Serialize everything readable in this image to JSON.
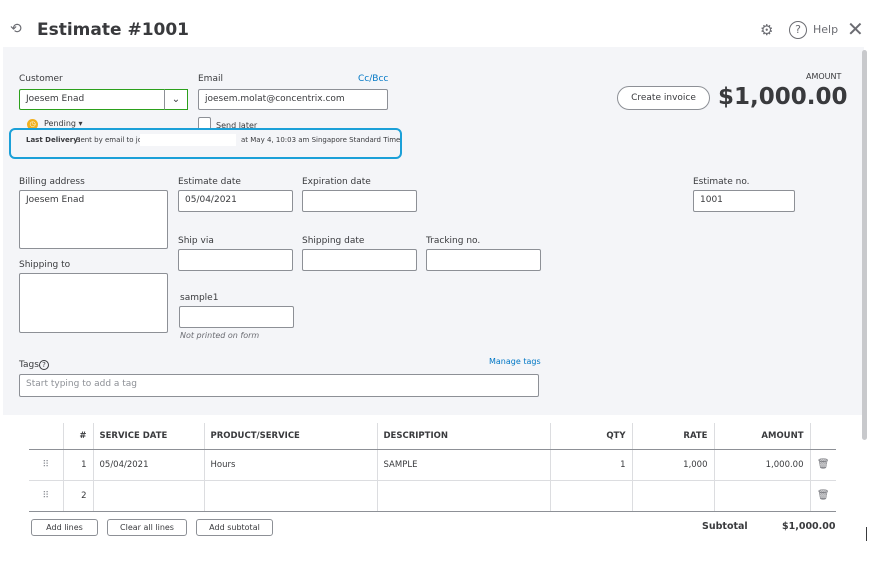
{
  "header": {
    "title": "Estimate #1001",
    "help_label": "Help",
    "history_icon": "history-icon",
    "gear_icon": "gear-icon",
    "close_icon": "close-icon"
  },
  "customer": {
    "label": "Customer",
    "value": "Joesem Enad",
    "status": "Pending ▾"
  },
  "email": {
    "label": "Email",
    "value": "joesem.molat@concentrix.com",
    "ccbcc": "Cc/Bcc",
    "send_later": "Send later"
  },
  "delivery": {
    "title": "Last Delivery:",
    "sent": "Sent by email to jo",
    "time": "at May 4, 10:03 am Singapore Standard Time"
  },
  "amount": {
    "label": "AMOUNT",
    "value": "$1,000.00",
    "create_invoice": "Create invoice"
  },
  "billing": {
    "label": "Billing address",
    "value": "Joesem Enad"
  },
  "shipping": {
    "label": "Shipping to",
    "value": ""
  },
  "estimate_date": {
    "label": "Estimate date",
    "value": "05/04/2021"
  },
  "expiration_date": {
    "label": "Expiration date",
    "value": ""
  },
  "estimate_no": {
    "label": "Estimate no.",
    "value": "1001"
  },
  "ship_via": {
    "label": "Ship via",
    "value": ""
  },
  "shipping_date": {
    "label": "Shipping date",
    "value": ""
  },
  "tracking_no": {
    "label": "Tracking no.",
    "value": ""
  },
  "sample1": {
    "label": "sample1",
    "value": "",
    "note": "Not printed on form"
  },
  "tags": {
    "label": "Tags",
    "manage": "Manage tags",
    "placeholder": "Start typing to add a tag"
  },
  "table": {
    "headers": [
      "#",
      "SERVICE DATE",
      "PRODUCT/SERVICE",
      "DESCRIPTION",
      "QTY",
      "RATE",
      "AMOUNT"
    ],
    "rows": [
      {
        "num": "1",
        "service_date": "05/04/2021",
        "product": "Hours",
        "description": "SAMPLE",
        "qty": "1",
        "rate": "1,000",
        "amount": "1,000.00"
      },
      {
        "num": "2",
        "service_date": "",
        "product": "",
        "description": "",
        "qty": "",
        "rate": "",
        "amount": ""
      }
    ]
  },
  "footer": {
    "add_lines": "Add lines",
    "clear_lines": "Clear all lines",
    "add_subtotal": "Add subtotal",
    "subtotal_label": "Subtotal",
    "subtotal_value": "$1,000.00"
  },
  "colors": {
    "accent_green": "#2ca01c",
    "link_blue": "#0077c5",
    "highlight_blue": "#1ba0d8",
    "pending_orange": "#f2b01e"
  }
}
